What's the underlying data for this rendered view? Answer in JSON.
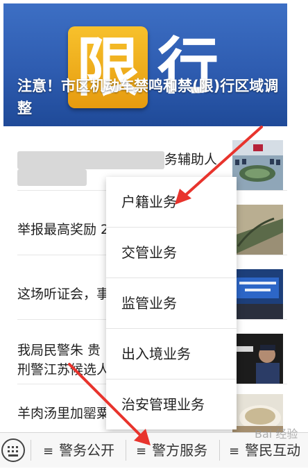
{
  "hero": {
    "sign_main": "限",
    "sign_second": "行",
    "title": "注意！市区机动车禁鸣和禁(限)行区域调整"
  },
  "news": [
    {
      "title": "务辅助人",
      "thumb": "meeting-room-photo"
    },
    {
      "title": "举报最高奖励 2",
      "thumb": "river-bank-photo"
    },
    {
      "title": "这场听证会，事",
      "thumb": "conference-screen-photo"
    },
    {
      "title": "我局民警朱 贵\n刑警江苏候选人",
      "thumb": "police-officer-photo"
    },
    {
      "title": "羊肉汤里加罂粟",
      "thumb": "soup-bowl-photo"
    }
  ],
  "menu": {
    "items": [
      "户籍业务",
      "交管业务",
      "监管业务",
      "出入境业务",
      "治安管理业务"
    ]
  },
  "tabbar": {
    "keyboard_icon": "keyboard-icon",
    "tabs": [
      "警务公开",
      "警方服务",
      "警民互动"
    ]
  },
  "watermark": "Bai 经验",
  "colors": {
    "hero_blue": "#2e5cb0",
    "sign_orange": "#f2b01e",
    "arrow_red": "#e8342d"
  }
}
